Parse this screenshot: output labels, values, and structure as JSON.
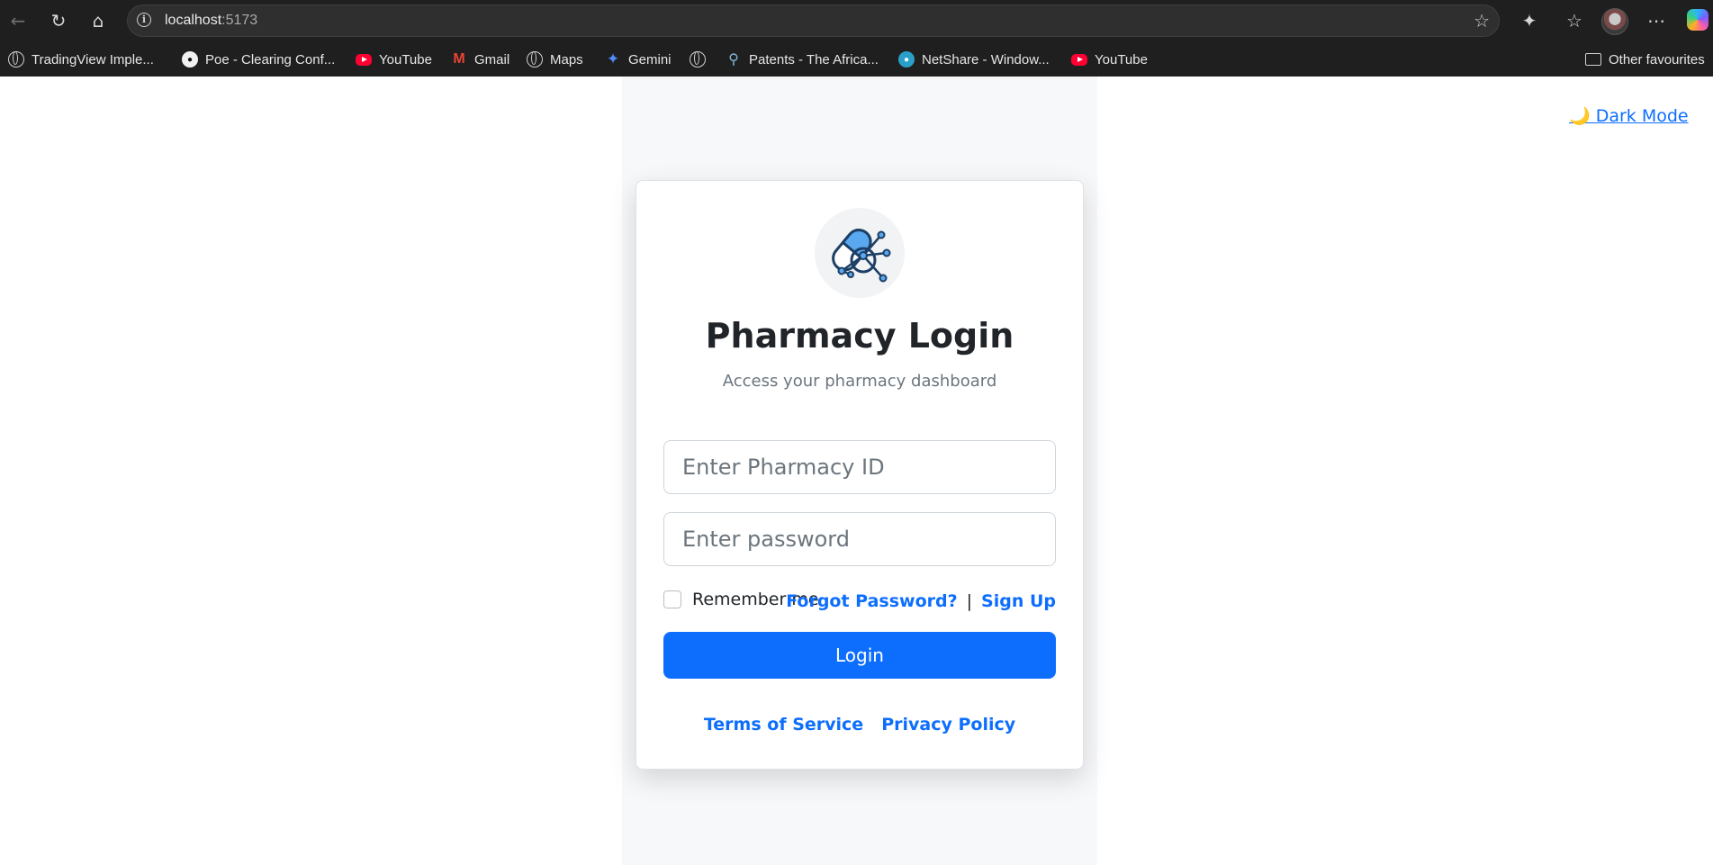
{
  "browser": {
    "url_host": "localhost",
    "url_port": ":5173",
    "bookmarks": [
      {
        "label": "TradingView Imple...",
        "icon": "globe-icon"
      },
      {
        "label": "Poe - Clearing Conf...",
        "icon": "poe-icon"
      },
      {
        "label": "YouTube",
        "icon": "youtube-icon"
      },
      {
        "label": "Gmail",
        "icon": "gmail-icon"
      },
      {
        "label": "Maps",
        "icon": "globe-icon"
      },
      {
        "label": "Gemini",
        "icon": "gemini-icon"
      },
      {
        "label": "",
        "icon": "globe-icon"
      },
      {
        "label": "Patents - The Africa...",
        "icon": "patent-icon"
      },
      {
        "label": "NetShare - Window...",
        "icon": "netshare-icon"
      },
      {
        "label": "YouTube",
        "icon": "youtube-icon"
      }
    ],
    "other_favourites": "Other favourites"
  },
  "page": {
    "dark_mode_toggle": "🌙 Dark Mode",
    "title": "Pharmacy Login",
    "subtitle": "Access your pharmacy dashboard",
    "pharmacy_id_placeholder": "Enter Pharmacy ID",
    "pharmacy_id_value": "",
    "password_placeholder": "Enter password",
    "password_value": "",
    "remember_me": "Remember me",
    "remember_checked": false,
    "forgot_password": "Forgot Password?",
    "separator": "|",
    "sign_up": "Sign Up",
    "login_button": "Login",
    "terms": "Terms of Service",
    "privacy": "Privacy Policy"
  },
  "colors": {
    "accent": "#0d6efd",
    "logo_blue": "#5aa9f0",
    "logo_outline": "#1d3f66"
  }
}
